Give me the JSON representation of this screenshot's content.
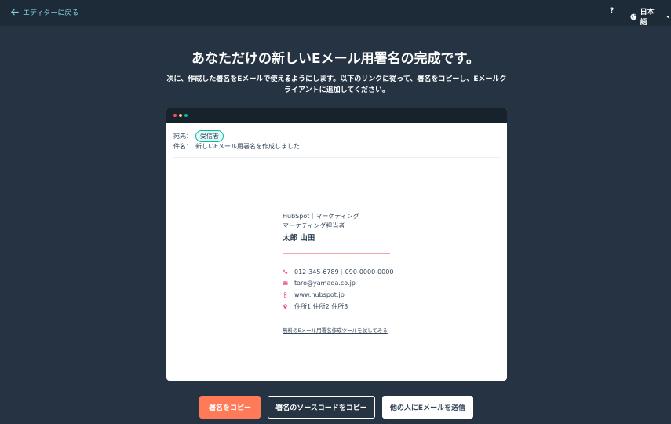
{
  "topbar": {
    "back_label": "エディターに戻る",
    "help_label": "?",
    "language_label": "日本語"
  },
  "heading": {
    "title": "あなただけの新しいEメール用署名の完成です。",
    "subtitle": "次に、作成した署名をEメールで使えるようにします。以下のリンクに従って、署名をコピーし、Eメールクライアントに追加してください。"
  },
  "preview": {
    "to_label": "宛先：",
    "to_value": "受信者",
    "subject_label": "件名：",
    "subject_value": "新しいEメール用署名を作成しました",
    "signature": {
      "company": "HubSpot｜マーケティング",
      "role": "マーケティング担当者",
      "name": "太郎 山田",
      "phone": "012-345-6789｜090-0000-0000",
      "email": "taro@yamada.co.jp",
      "website": "www.hubspot.jp",
      "address": "住所1 住所2 住所3"
    },
    "try_link": "無料のEメール用署名作成ツールを試してみる"
  },
  "actions": {
    "copy_signature": "署名をコピー",
    "copy_source": "署名のソースコードをコピー",
    "send_email": "他の人にEメールを送信"
  },
  "colors": {
    "background": "#253342",
    "topbar": "#1d2a38",
    "accent_orange": "#ff7a59",
    "link_teal": "#7fd1de",
    "icon_pink": "#f2547d"
  }
}
